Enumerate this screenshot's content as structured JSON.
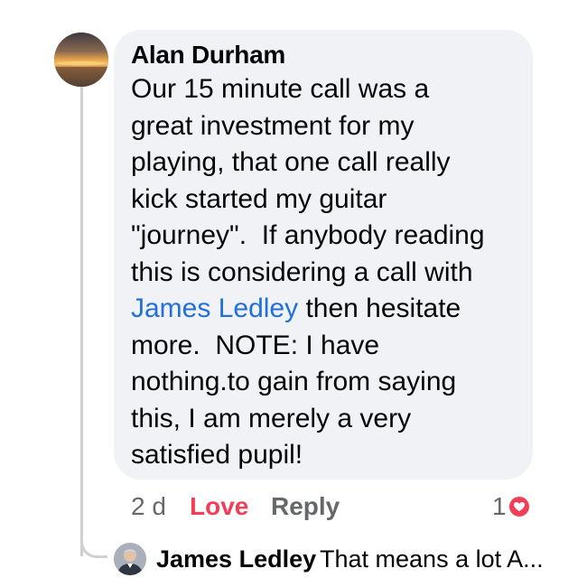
{
  "comment": {
    "author": "Alan Durham",
    "avatar_icon": "sunset-avatar",
    "text_lines": [
      "Our 15 minute call was a",
      "great investment for my",
      "playing, that one call really",
      "kick started my guitar",
      "\"journey\".  If anybody reading",
      "this is considering a call with"
    ],
    "mention": "James Ledley",
    "mention_line_rest": " then hesitate",
    "text_lines_after": [
      "more.  NOTE: I have",
      "nothing.to gain from saying",
      "this, I am merely a very",
      "satisfied pupil!"
    ],
    "mention_color": "#216fdb"
  },
  "actions": {
    "time": "2 d",
    "love_label": "Love",
    "reply_label": "Reply",
    "love_color": "#f33e58"
  },
  "reaction": {
    "count": "1",
    "icon": "heart-icon"
  },
  "reply": {
    "author": "James Ledley",
    "preview": "That means a lot A...",
    "avatar_icon": "profile-avatar"
  }
}
